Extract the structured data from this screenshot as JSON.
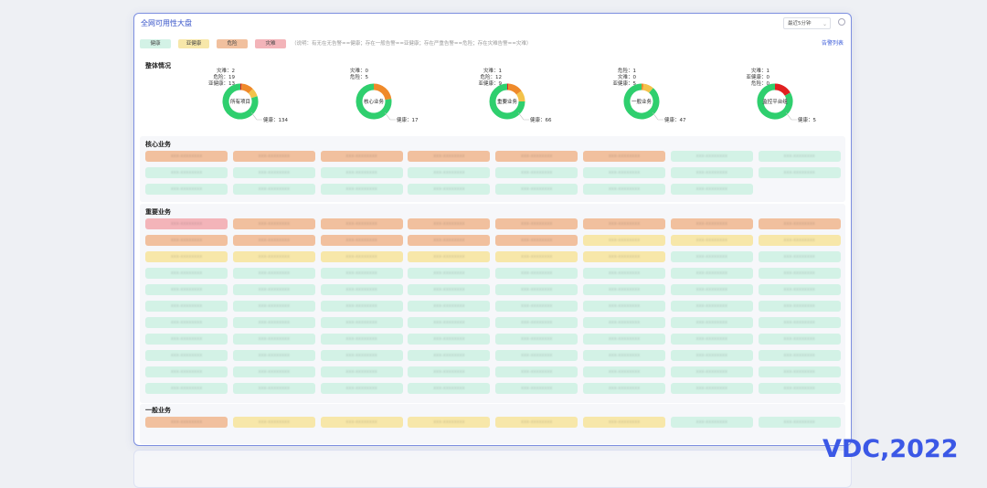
{
  "window": {
    "title": "全网可用性大盘",
    "time_range": "最近5分钟"
  },
  "legend": {
    "items": [
      {
        "label": "健康",
        "color": "#d3f2e6"
      },
      {
        "label": "亚健康",
        "color": "#f7e7a9"
      },
      {
        "label": "危险",
        "color": "#f1c09e"
      },
      {
        "label": "灾难",
        "color": "#f3b4b9"
      }
    ],
    "note": "（说明：有无在无告警==健康；存在一般告警==亚健康；存在严重告警==危险；存在灾难告警==灾难）",
    "alarm_link": "告警列表"
  },
  "overview": {
    "title": "整体情况",
    "donuts": [
      {
        "center": "所有项目",
        "healthy": 134,
        "subhealth": 13,
        "danger": 19,
        "disaster": 2,
        "labels": {
          "disaster": "灾难：2",
          "danger": "危险：19",
          "subhealth": "亚健康：13",
          "healthy": "健康：134"
        }
      },
      {
        "center": "核心业务",
        "healthy": 17,
        "subhealth": 0,
        "danger": 5,
        "disaster": 0,
        "labels": {
          "disaster": "灾难：0",
          "danger": "危险：5",
          "healthy": "健康：17"
        }
      },
      {
        "center": "重要业务",
        "healthy": 66,
        "subhealth": 9,
        "danger": 12,
        "disaster": 1,
        "labels": {
          "disaster": "灾难：1",
          "danger": "危险：12",
          "subhealth": "亚健康：9",
          "healthy": "健康：66"
        }
      },
      {
        "center": "一般业务",
        "healthy": 47,
        "subhealth": 5,
        "danger": 1,
        "disaster": 0,
        "labels": {
          "danger": "危险：1",
          "disaster": "灾难：0",
          "subhealth": "亚健康：5",
          "healthy": "健康：47"
        }
      },
      {
        "center": "监控平台组",
        "healthy": 5,
        "subhealth": 0,
        "danger": 0,
        "disaster": 1,
        "labels": {
          "disaster": "灾难：1",
          "subhealth": "亚健康：0",
          "danger": "危险：0",
          "healthy": "健康：5"
        }
      }
    ]
  },
  "sections": [
    {
      "title": "核心业务",
      "tiles": [
        "danger",
        "danger",
        "danger",
        "danger",
        "danger",
        "danger",
        "healthy",
        "healthy",
        "healthy",
        "healthy",
        "healthy",
        "healthy",
        "healthy",
        "healthy",
        "healthy",
        "healthy",
        "healthy",
        "healthy",
        "healthy",
        "healthy",
        "healthy",
        "healthy",
        "healthy"
      ]
    },
    {
      "title": "重要业务",
      "tiles": [
        "disaster",
        "danger",
        "danger",
        "danger",
        "danger",
        "danger",
        "danger",
        "danger",
        "danger",
        "danger",
        "danger",
        "danger",
        "danger",
        "subhealth",
        "subhealth",
        "subhealth",
        "subhealth",
        "subhealth",
        "subhealth",
        "subhealth",
        "subhealth",
        "subhealth",
        "healthy",
        "healthy",
        "healthy",
        "healthy",
        "healthy",
        "healthy",
        "healthy",
        "healthy",
        "healthy",
        "healthy",
        "healthy",
        "healthy",
        "healthy",
        "healthy",
        "healthy",
        "healthy",
        "healthy",
        "healthy",
        "healthy",
        "healthy",
        "healthy",
        "healthy",
        "healthy",
        "healthy",
        "healthy",
        "healthy",
        "healthy",
        "healthy",
        "healthy",
        "healthy",
        "healthy",
        "healthy",
        "healthy",
        "healthy",
        "healthy",
        "healthy",
        "healthy",
        "healthy",
        "healthy",
        "healthy",
        "healthy",
        "healthy",
        "healthy",
        "healthy",
        "healthy",
        "healthy",
        "healthy",
        "healthy",
        "healthy",
        "healthy",
        "healthy",
        "healthy",
        "healthy",
        "healthy",
        "healthy",
        "healthy",
        "healthy",
        "healthy",
        "healthy",
        "healthy",
        "healthy",
        "healthy",
        "healthy",
        "healthy",
        "healthy",
        "healthy"
      ]
    },
    {
      "title": "一般业务",
      "tiles": [
        "danger",
        "subhealth",
        "subhealth",
        "subhealth",
        "subhealth",
        "subhealth",
        "healthy",
        "healthy"
      ]
    }
  ],
  "tile_placeholder": "xxx-xxxxxxxx",
  "watermark": "VDC,2022"
}
